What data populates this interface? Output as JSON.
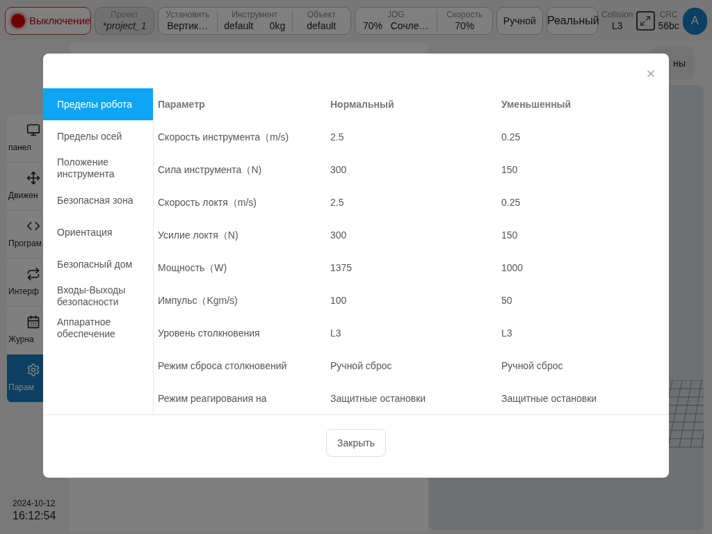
{
  "top_bar": {
    "power": {
      "label": "Выключение",
      "on": false
    },
    "project": {
      "label": "Проект",
      "value": "*project_1"
    },
    "groups": [
      [
        {
          "label": "Установить",
          "value": "Вертик…"
        },
        {
          "label": "Инструмент",
          "value": "default      0kg"
        },
        {
          "label": "Объект",
          "value": "default"
        }
      ],
      [
        {
          "label": "JOG",
          "value": "70%   Сочле…"
        },
        {
          "label": "Скорость",
          "value": "70%"
        }
      ]
    ],
    "mode_buttons": [
      "Ручной",
      "Реальный"
    ],
    "collision": {
      "label": "Collision",
      "value": "L3"
    },
    "crc": {
      "label": "CRC",
      "value": "56bc"
    },
    "avatar": "A"
  },
  "sidebar": {
    "items": [
      {
        "label": "панел",
        "selected": false
      },
      {
        "label": "Движен",
        "selected": false
      },
      {
        "label": "Програм",
        "selected": false
      },
      {
        "label": "Интерф",
        "selected": false
      },
      {
        "label": "Журна",
        "selected": false
      },
      {
        "label": "Парам",
        "selected": true
      }
    ],
    "date": "2024-10-12",
    "time": "16:12:54"
  },
  "background_button": "ны",
  "dialog": {
    "menu": [
      {
        "label": "Пределы робота",
        "selected": true
      },
      {
        "label": "Пределы осей",
        "selected": false
      },
      {
        "label": "Положение инструмента",
        "selected": false
      },
      {
        "label": "Безопасная зона",
        "selected": false
      },
      {
        "label": "Ориентация",
        "selected": false
      },
      {
        "label": "Безопасный дом",
        "selected": false
      },
      {
        "label": "Входы-Выходы безопасности",
        "selected": false
      },
      {
        "label": "Аппаратное обеспечение",
        "selected": false
      }
    ],
    "columns": [
      "Параметр",
      "Нормальный",
      "Уменьшенный"
    ],
    "rows": [
      [
        "Скорость инструмента（m/s)",
        "2.5",
        "0.25"
      ],
      [
        "Сила инструмента（N)",
        "300",
        "150"
      ],
      [
        "Скорость локтя（m/s)",
        "2.5",
        "0.25"
      ],
      [
        "Усилие локтя（N)",
        "300",
        "150"
      ],
      [
        "Мощность（W)",
        "1375",
        "1000"
      ],
      [
        "Импульс（Kgm/s)",
        "100",
        "50"
      ],
      [
        "Уровень столкновения",
        "L3",
        "L3"
      ],
      [
        "Режим сброса столкновений",
        "Ручной сброс",
        "Ручной сброс"
      ],
      [
        "Режим реагирования на",
        "Защитные остановки",
        "Защитные остановки"
      ]
    ],
    "close_button": "Закрыть"
  }
}
